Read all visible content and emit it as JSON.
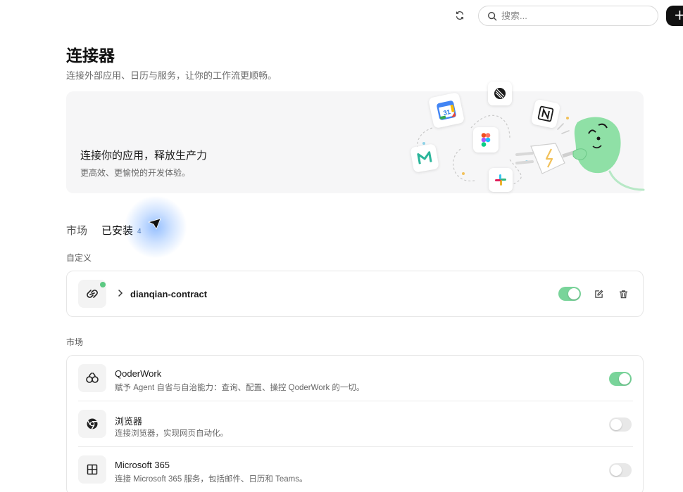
{
  "topbar": {
    "search_placeholder": "搜索...",
    "add_label": "+"
  },
  "header": {
    "title": "连接器",
    "subtitle": "连接外部应用、日历与服务，让你的工作流更顺畅。"
  },
  "banner": {
    "title": "连接你的应用，释放生产力",
    "subtitle": "更高效、更愉悦的开发体验。",
    "calendar_day": "31"
  },
  "tabs": [
    {
      "label": "市场"
    },
    {
      "label": "已安装",
      "count": "4"
    }
  ],
  "custom_section": {
    "label": "自定义",
    "items": [
      {
        "name": "dianqian-contract",
        "enabled": true
      }
    ]
  },
  "market_section": {
    "label": "市场",
    "items": [
      {
        "name": "QoderWork",
        "desc": "赋予 Agent 自省与自治能力：查询、配置、操控 QoderWork 的一切。",
        "enabled": true,
        "icon": "qoderwork-icon"
      },
      {
        "name": "浏览器",
        "desc": "连接浏览器，实现网页自动化。",
        "enabled": false,
        "icon": "chrome-icon"
      },
      {
        "name": "Microsoft 365",
        "desc": "连接 Microsoft 365 服务，包括邮件、日历和 Teams。",
        "enabled": false,
        "icon": "windows-grid-icon"
      }
    ]
  },
  "colors": {
    "accent_green": "#79d49a",
    "status_dot": "#5cc982",
    "banner_bg": "#f6f6f7",
    "glow_blue": "#408cff"
  }
}
